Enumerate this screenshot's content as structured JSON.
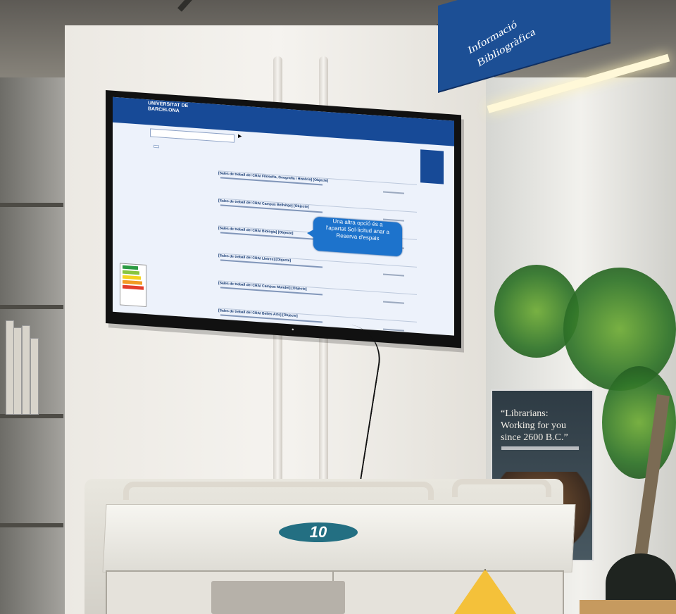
{
  "scene": {
    "sign": {
      "lines": [
        "Informació",
        "Bibliogràfica"
      ]
    },
    "screen": {
      "logo_lines": [
        "UNIVERSITAT DE",
        "BARCELONA"
      ],
      "tooltip_lines": [
        "Una altra opció és a",
        "l'apartat Sol·licitud anar a",
        "Reserva d'espais"
      ],
      "results": [
        "[Sales de treball del CRAI Filosofia, Geografia i Història] [Objecte]",
        "[Sales de treball del CRAI Campus Bellvitge] [Objecte]",
        "[Sales de treball del CRAI Biologia] [Objecte]",
        "[Sales de treball del CRAI Lletres] [Objecte]",
        "[Sales de treball del CRAI Campus Mundet] [Objecte]",
        "[Sales de treball del CRAI Belles Arts] [Objecte]"
      ]
    },
    "poster": {
      "quote_lines": [
        "“Librarians:",
        "Working for you",
        "since 2600 B.C.”"
      ]
    },
    "cart_badge": "10"
  }
}
